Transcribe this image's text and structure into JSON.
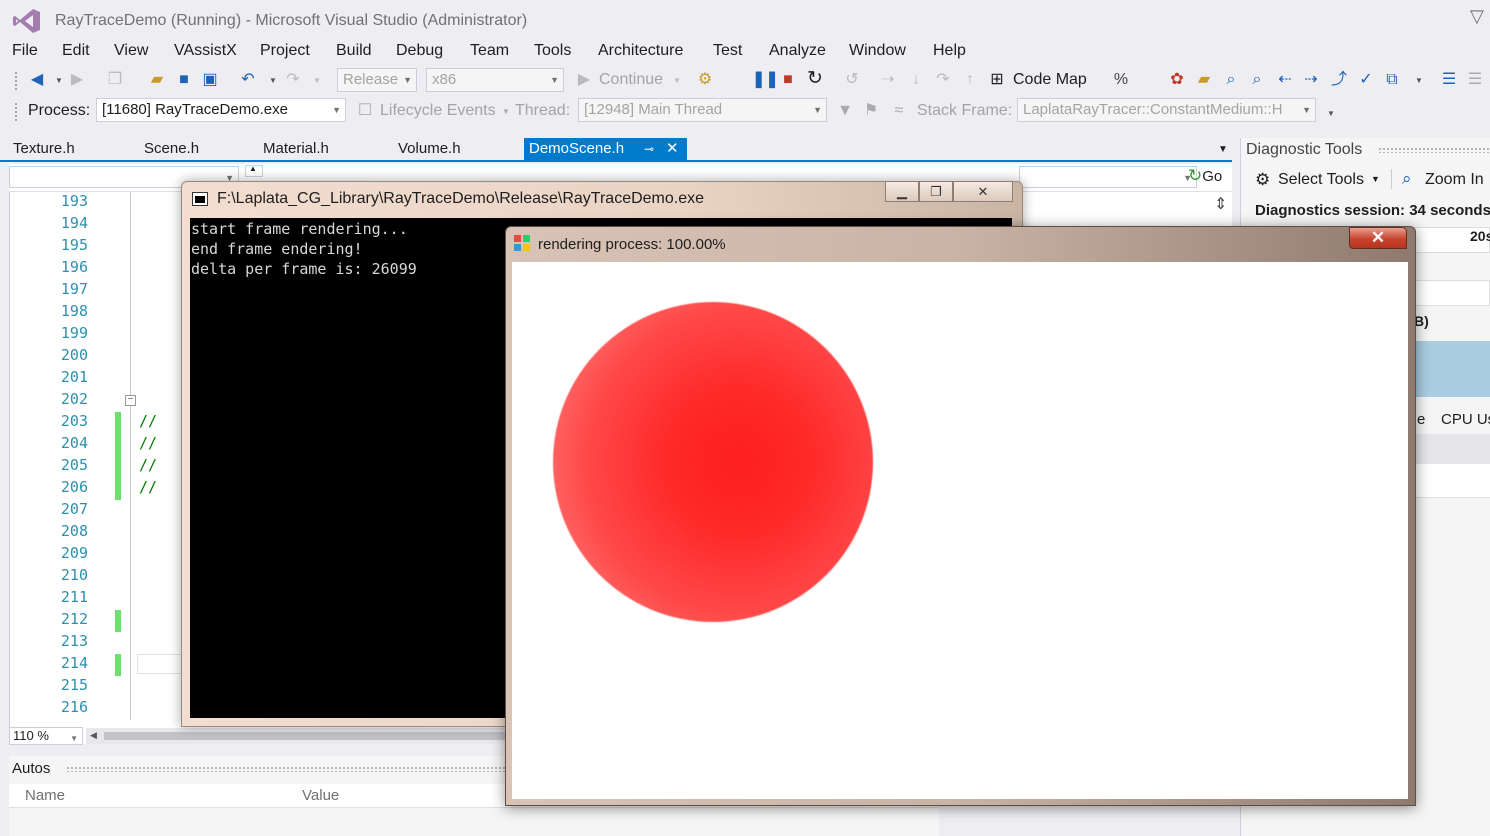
{
  "window": {
    "title": "RayTraceDemo (Running) - Microsoft Visual Studio (Administrator)"
  },
  "menu": [
    "File",
    "Edit",
    "View",
    "VAssistX",
    "Project",
    "Build",
    "Debug",
    "Team",
    "Tools",
    "Architecture",
    "Test",
    "Analyze",
    "Window",
    "Help"
  ],
  "toolbar": {
    "config": "Release",
    "platform": "x86",
    "continue_label": "Continue",
    "code_map_label": "Code Map"
  },
  "debug_location": {
    "process_label": "Process:",
    "process_value": "[11680] RayTraceDemo.exe",
    "lifecycle_label": "Lifecycle Events",
    "thread_label": "Thread:",
    "thread_value": "[12948] Main Thread",
    "stack_frame_label": "Stack Frame:",
    "stack_frame_value": "LaplataRayTracer::ConstantMedium::H"
  },
  "tabs": [
    {
      "label": "Texture.h",
      "active": false
    },
    {
      "label": "Scene.h",
      "active": false
    },
    {
      "label": "Material.h",
      "active": false
    },
    {
      "label": "Volume.h",
      "active": false
    },
    {
      "label": "DemoScene.h",
      "active": true
    }
  ],
  "editor": {
    "go_label": "Go",
    "line_numbers": [
      "193",
      "194",
      "195",
      "196",
      "197",
      "198",
      "199",
      "200",
      "201",
      "202",
      "203",
      "204",
      "205",
      "206",
      "207",
      "208",
      "209",
      "210",
      "211",
      "212",
      "213",
      "214",
      "215",
      "216"
    ],
    "comment_text": "//",
    "zoom": "110 %"
  },
  "console_window": {
    "title": "F:\\Laplata_CG_Library\\RayTraceDemo\\Release\\RayTraceDemo.exe",
    "lines": [
      "start frame rendering...",
      "end frame endering!",
      "delta per frame is: 26099"
    ]
  },
  "render_window": {
    "title": "rendering process: 100.00%",
    "close_glyph": "✕",
    "sphere_color": "#ff2020"
  },
  "autos": {
    "title": "Autos",
    "columns": [
      "Name",
      "Value"
    ]
  },
  "diagnostics": {
    "title": "Diagnostic Tools",
    "select_tools_label": "Select Tools",
    "zoom_in_label": "Zoom In",
    "session_text": "Diagnostics session: 34 seconds",
    "axis_tick": "20s",
    "memory_suffix": "B)",
    "cpu_label": "CPU Us",
    "tab_suffix": "e"
  },
  "colors": {
    "accent": "#007acc",
    "change_marker": "#6ce26c",
    "line_number": "#2b91af",
    "comment": "#008000"
  }
}
